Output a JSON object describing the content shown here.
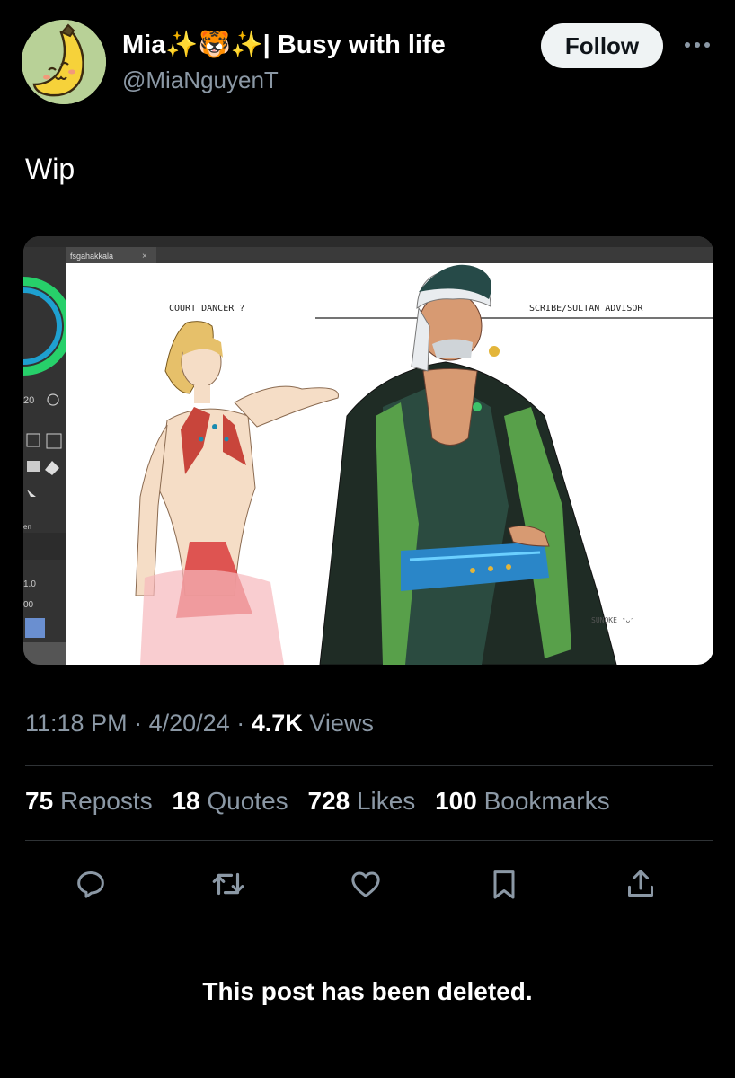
{
  "author": {
    "display_name": "Mia✨🐯✨| Busy with life",
    "handle": "@MiaNguyenT",
    "follow_label": "Follow"
  },
  "post": {
    "text": "Wip",
    "image": {
      "tab_label": "fsgahakkala",
      "left_caption": "COURT DANCER ?",
      "right_caption": "SCRIBE/SULTAN ADVISOR",
      "signature": "SUNOKE ᵔᴗᵔ",
      "panel_number": "20",
      "panel_label_en": "en",
      "panel_value_1": "1.0",
      "panel_value_2": "00"
    },
    "time": "11:18 PM",
    "date": "4/20/24",
    "views_count": "4.7K",
    "views_label": "Views",
    "separator": "·"
  },
  "stats": {
    "reposts": {
      "count": "75",
      "label": "Reposts"
    },
    "quotes": {
      "count": "18",
      "label": "Quotes"
    },
    "likes": {
      "count": "728",
      "label": "Likes"
    },
    "bookmarks": {
      "count": "100",
      "label": "Bookmarks"
    }
  },
  "actions": [
    "reply-icon",
    "repost-icon",
    "like-icon",
    "bookmark-icon",
    "share-icon"
  ],
  "deleted_notice": "This post has been deleted.",
  "colors": {
    "background": "#000000",
    "secondary_text": "#8b98a5",
    "follow_bg": "#eff3f4"
  }
}
